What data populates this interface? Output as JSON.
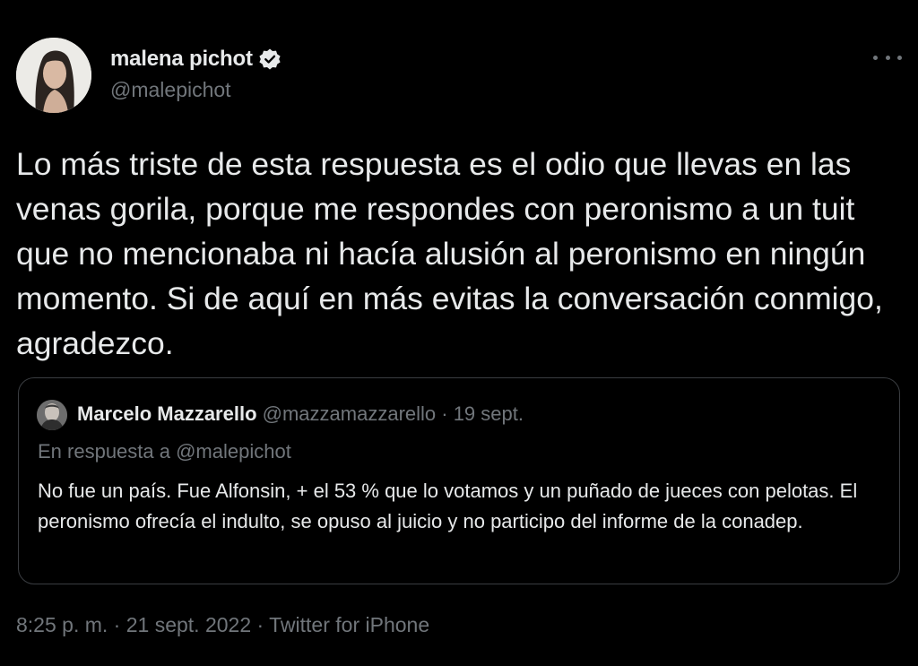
{
  "tweet": {
    "author": {
      "name": "malena pichot",
      "handle": "@malepichot",
      "verified": true
    },
    "text": "Lo más triste de esta respuesta es el odio que llevas en las venas gorila, porque me respondes con peronismo a un tuit que no mencionaba ni hacía alusión al peronismo en ningún momento. Si de aquí en más evitas la conversación conmigo, agradezco.",
    "more_icon": "more-horizontal-icon",
    "quoted": {
      "name": "Marcelo Mazzarello",
      "meta": "@mazzamazzarello · 19 sept.",
      "reply_to": "En respuesta a @malepichot",
      "text": "No fue un país. Fue Alfonsin, + el 53 % que lo votamos  y un puñado de jueces con pelotas. El peronismo ofrecía el indulto, se opuso al juicio  y no participo del informe de la conadep."
    },
    "footer": {
      "timestamp": "8:25 p. m. · 21 sept. 2022 · ",
      "source": "Twitter for iPhone"
    }
  },
  "colors": {
    "background": "#000000",
    "text": "#e7e9ea",
    "secondary": "#71767b",
    "border": "#3a3d41"
  }
}
